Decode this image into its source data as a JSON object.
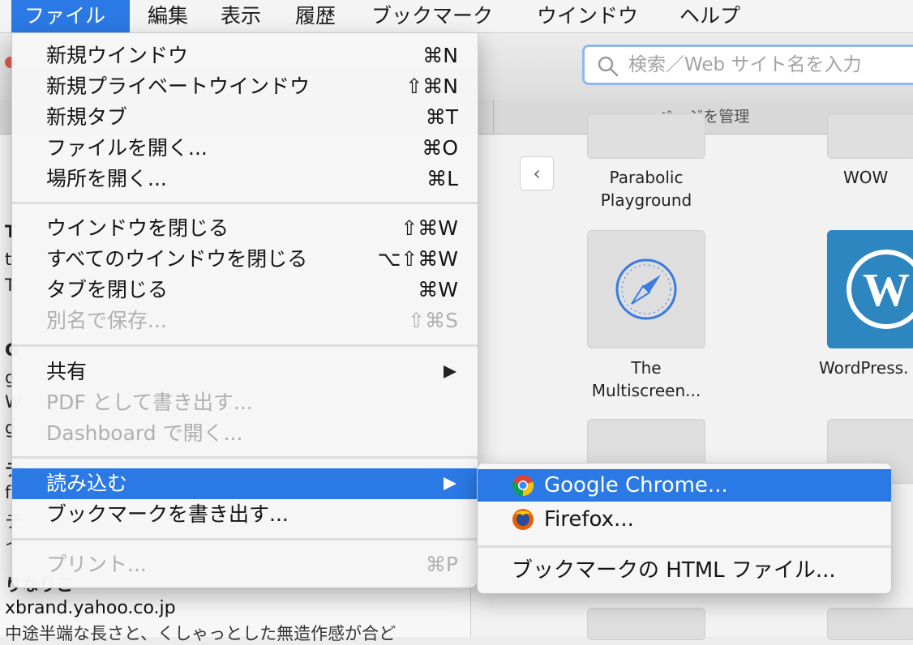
{
  "menubar": {
    "items": [
      "ファイル",
      "編集",
      "表示",
      "履歴",
      "ブックマーク",
      "ウインドウ",
      "ヘルプ"
    ]
  },
  "toolbar": {
    "search_placeholder": "検索／Web サイト名を入力"
  },
  "tabbar": {
    "manage_label": "ページを管理"
  },
  "content": {
    "tiles": [
      {
        "label1": "Parabolic",
        "label2": "Playground"
      },
      {
        "label1": "WOW",
        "label2": ""
      },
      {
        "label1": "The",
        "label2": "Multiscreen..."
      },
      {
        "label1": "WordPress.",
        "label2": ""
      }
    ]
  },
  "sidebar": {
    "fragments": [
      "T",
      "t",
      "T",
      "G",
      "g",
      "W",
      "g",
      "テ",
      "f",
      "テ",
      "イ",
      "りなりこ"
    ],
    "url": "xbrand.yahoo.co.jp",
    "desc": "中途半端な長さと、くしゃっとした無造作感が合ど"
  },
  "file_menu": {
    "items": [
      {
        "label": "新規ウインドウ",
        "shortcut": "⌘N",
        "enabled": true
      },
      {
        "label": "新規プライベートウインドウ",
        "shortcut": "⇧⌘N",
        "enabled": true
      },
      {
        "label": "新規タブ",
        "shortcut": "⌘T",
        "enabled": true
      },
      {
        "label": "ファイルを開く...",
        "shortcut": "⌘O",
        "enabled": true
      },
      {
        "label": "場所を開く...",
        "shortcut": "⌘L",
        "enabled": true
      },
      {
        "label": "ウインドウを閉じる",
        "shortcut": "⇧⌘W",
        "enabled": true
      },
      {
        "label": "すべてのウインドウを閉じる",
        "shortcut": "⌥⇧⌘W",
        "enabled": true
      },
      {
        "label": "タブを閉じる",
        "shortcut": "⌘W",
        "enabled": true
      },
      {
        "label": "別名で保存...",
        "shortcut": "⇧⌘S",
        "enabled": false
      },
      {
        "label": "共有",
        "shortcut": "",
        "enabled": true
      },
      {
        "label": "PDF として書き出す...",
        "shortcut": "",
        "enabled": false
      },
      {
        "label": "Dashboard で開く...",
        "shortcut": "",
        "enabled": false
      },
      {
        "label": "読み込む",
        "shortcut": "",
        "enabled": true
      },
      {
        "label": "ブックマークを書き出す...",
        "shortcut": "",
        "enabled": true
      },
      {
        "label": "プリント...",
        "shortcut": "⌘P",
        "enabled": false
      }
    ]
  },
  "import_submenu": {
    "items": [
      "Google Chrome...",
      "Firefox...",
      "ブックマークの HTML ファイル..."
    ]
  },
  "colors": {
    "highlight": "#2b79e4",
    "disabled_text": "#b0b0b0"
  }
}
